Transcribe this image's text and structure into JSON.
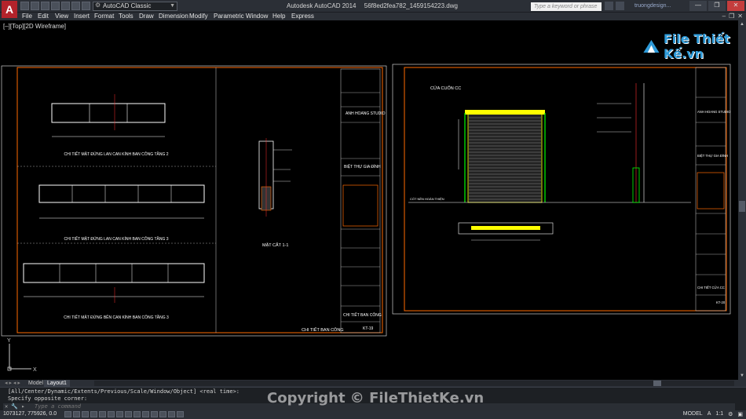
{
  "titlebar": {
    "app_logo": "A",
    "workspace": "AutoCAD Classic",
    "app_name": "Autodesk AutoCAD 2014",
    "file_name": "56f8ed2fea782_1459154223.dwg",
    "search_placeholder": "Type a keyword or phrase",
    "user": "truongdesign...",
    "win_min": "—",
    "win_max": "❐",
    "win_close": "✕"
  },
  "menu": [
    {
      "label": "File"
    },
    {
      "label": "Edit"
    },
    {
      "label": "View"
    },
    {
      "label": "Insert"
    },
    {
      "label": "Format"
    },
    {
      "label": "Tools"
    },
    {
      "label": "Draw"
    },
    {
      "label": "Dimension"
    },
    {
      "label": "Modify"
    },
    {
      "label": "Parametric"
    },
    {
      "label": "Window"
    },
    {
      "label": "Help"
    },
    {
      "label": "Express"
    }
  ],
  "viewport": {
    "label": "[–][Top][2D Wireframe]",
    "watermark_text": "File Thiết Kế.vn"
  },
  "drawing_left": {
    "title_1": "CHI TIẾT MẶT ĐỨNG LAN CAN KÍNH BAN CÔNG TẦNG 2",
    "title_2": "CHI TIẾT MẶT ĐỨNG LAN CAN KÍNH BAN CÔNG TẦNG 3",
    "title_3": "CHI TIẾT MẶT ĐỨNG BÊN CAN KÍNH BAN CÔNG TẦNG 3",
    "section_title": "MẶT CẮT 1-1",
    "sheet_title": "CHI TIẾT BAN CÔNG",
    "tb_company": "ANH HOANG STUDIO",
    "tb_project": "BIỆT THỰ GIA ĐÌNH",
    "tb_sheet_name": "CHI TIẾT BAN CÔNG",
    "tb_sheet_no": "KT-19"
  },
  "drawing_right": {
    "title": "CỬA CUỐN CC",
    "floor_label": "CỐT NỀN HOÀN THIỆN",
    "sheet_title": "CHI TIẾT CỬA CC",
    "tb_company": "ANH HOANG STUDIO",
    "tb_project": "BIỆT THỰ GIA ĐÌNH",
    "tb_sheet_name": "CHI TIẾT CỬA CC",
    "tb_sheet_no": "KT-20"
  },
  "tabs": [
    {
      "label": "Model"
    },
    {
      "label": "Layout1"
    }
  ],
  "command": {
    "history_1": "[All/Center/Dynamic/Extents/Previous/Scale/Window/Object] <real time>:",
    "history_2": "Specify opposite corner:",
    "placeholder": "Type a command",
    "ctrl_icons": "✕ 🔧 ▸"
  },
  "status": {
    "coords": "1073127, 775926, 0.0",
    "model": "MODEL",
    "scale": "1:1",
    "ucs": "A"
  },
  "copyright": "Copyright © FileThietKe.vn",
  "colors": {
    "frame": "#ff6a00",
    "cad_white": "#ffffff",
    "cad_yellow": "#ffff00",
    "cad_green": "#00ff00",
    "cad_cyan": "#00d8ff",
    "cad_red": "#ff2d2d"
  }
}
